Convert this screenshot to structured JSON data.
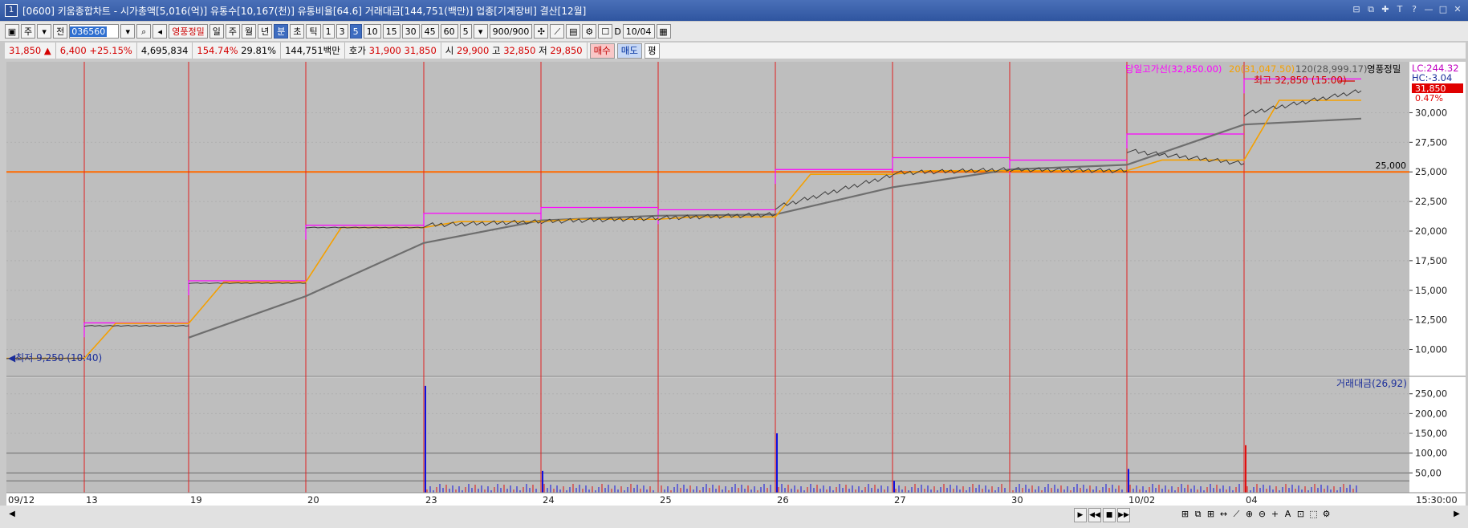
{
  "window": {
    "screen_no": "1",
    "title": "[0600] 키움종합차트 - 시가총액[5,016(억)] 유통수[10,167(천)] 유통비율[64.6] 거래대금[144,751(백만)] 업종[기계장비] 결산[12월]",
    "buttons": [
      "⊟",
      "⧉",
      "✚",
      "T",
      "?",
      "—",
      "□",
      "✕"
    ]
  },
  "toolbar": {
    "period_type": "주",
    "prev_label": "전",
    "stock_code": "036560",
    "stock_name": "영풍정밀",
    "periods": [
      "일",
      "주",
      "월",
      "년",
      "분",
      "초",
      "틱"
    ],
    "period_selected": "분",
    "intervals": [
      "1",
      "3",
      "5",
      "10",
      "15",
      "30",
      "45",
      "60"
    ],
    "interval_selected": "5",
    "count_value": "5",
    "count_display": "900",
    "count_total": "/900",
    "date_check_label": "D",
    "date_value": "10/04"
  },
  "quote": {
    "price": "31,850",
    "arrow": "▲",
    "change": "6,400",
    "change_rate": "+25.15%",
    "volume": "4,695,834",
    "vol_ratio": "154.74%",
    "turnover": "29.81%",
    "amount": "144,751백만",
    "hoga_label": "호가",
    "ask": "31,900",
    "bid": "31,850",
    "open_label": "시",
    "open": "29,900",
    "high_label": "고",
    "high": "32,850",
    "low_label": "저",
    "low": "29,850",
    "buy_label": "매수",
    "sell_label": "매도",
    "flat_label": "평"
  },
  "chart_data": {
    "type": "line",
    "stock": "영풍정밀",
    "legend": {
      "high_line": "당일고가선(32,850.00)",
      "ma20": "20(31,047.50)",
      "ma120": "120(28,999.17)"
    },
    "top_right": {
      "lc": "LC:244.32",
      "hc": "HC:-3.04",
      "price_tag": "31,850",
      "pct_tag": "0.47%"
    },
    "annotations": {
      "high": "최고 32,850 (15:00)",
      "low": "최저 9,250 (10:40)",
      "hline_label": "25,000"
    },
    "hline_value": 25000,
    "price_axis": [
      "30,000",
      "27,500",
      "25,000",
      "22,500",
      "20,000",
      "17,500",
      "15,000",
      "12,500",
      "10,000"
    ],
    "price_axis_values": [
      30000,
      27500,
      25000,
      22500,
      20000,
      17500,
      15000,
      12500,
      10000
    ],
    "ylim": [
      7800,
      34300
    ],
    "x_labels": [
      "09/12",
      "13",
      "19",
      "20",
      "23",
      "24",
      "25",
      "26",
      "27",
      "30",
      "10/02",
      "04"
    ],
    "x_end_label": "15:30:00",
    "days": [
      "09/12",
      "09/13",
      "09/19",
      "09/20",
      "09/23",
      "09/24",
      "09/25",
      "09/26",
      "09/27",
      "09/30",
      "10/02",
      "10/04"
    ],
    "price_series": [
      {
        "day": "09/12",
        "start": 9250,
        "end": 9250
      },
      {
        "day": "09/13",
        "start": 12000,
        "end": 12000
      },
      {
        "day": "09/19",
        "start": 15600,
        "end": 15600
      },
      {
        "day": "09/20",
        "start": 20300,
        "end": 20300
      },
      {
        "day": "09/23",
        "start": 20500,
        "end": 20800
      },
      {
        "day": "09/24",
        "start": 20800,
        "end": 21100
      },
      {
        "day": "09/25",
        "start": 21100,
        "end": 21400
      },
      {
        "day": "09/26",
        "start": 22000,
        "end": 24700
      },
      {
        "day": "09/27",
        "start": 24900,
        "end": 25200
      },
      {
        "day": "09/30",
        "start": 25200,
        "end": 25100
      },
      {
        "day": "10/02",
        "start": 26800,
        "end": 25700
      },
      {
        "day": "10/04",
        "start": 29900,
        "end": 31850
      }
    ],
    "day_high_series": [
      null,
      12250,
      15800,
      20500,
      21500,
      22000,
      21800,
      25200,
      26200,
      26000,
      28200,
      32850
    ],
    "ma20_series": [
      9250,
      12200,
      15700,
      20300,
      20800,
      21000,
      21200,
      24800,
      25100,
      25100,
      26000,
      31047.5
    ],
    "ma120_series": [
      null,
      null,
      11000,
      14500,
      19000,
      20900,
      21300,
      21400,
      23700,
      25200,
      25600,
      28999.17
    ],
    "volume_panel": {
      "legend": "거래대금(26,92)",
      "axis": [
        "250,00",
        "200,00",
        "150,00",
        "100,00",
        "50,00"
      ],
      "axis_values": [
        250,
        200,
        150,
        100,
        50
      ],
      "ylim": [
        0,
        290
      ],
      "spikes": [
        {
          "day": "09/23",
          "value": 270
        },
        {
          "day": "09/24",
          "value": 55
        },
        {
          "day": "09/26",
          "value": 150
        },
        {
          "day": "09/27",
          "value": 30
        },
        {
          "day": "10/02",
          "value": 60
        },
        {
          "day": "10/04",
          "value": 120
        }
      ]
    },
    "colors": {
      "panel_bg": "#bebebe",
      "price_line": "#3a3a3a",
      "ma20": "#f5a000",
      "ma120": "#6e6e6e",
      "high_line": "#ff00ff",
      "day_separator": "#e02020",
      "hline": "#ff6a00",
      "vol_up": "#e01010",
      "vol_down": "#1010e0"
    }
  },
  "statusbar": {
    "time_label": "15:30:00",
    "nav": [
      "▶",
      "◀◀",
      "■",
      "▶▶"
    ],
    "tools": [
      "⊞",
      "⧉",
      "⊞",
      "↔",
      "⟋",
      "⊕",
      "⊖",
      "+",
      "A",
      "⊡",
      "⬚",
      "⚙"
    ]
  }
}
